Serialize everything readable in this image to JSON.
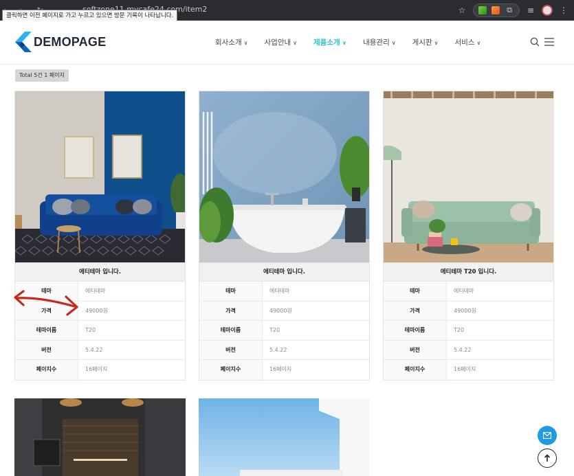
{
  "browser": {
    "url": "softzone11.mycafe24.com/item2",
    "tooltip": "클릭하면 이전 페이지로 가고 누르고 있으면 방문 기록이 나타납니다."
  },
  "site": {
    "logo_text": "DEMOPAGE",
    "nav": [
      {
        "label": "회사소개",
        "active": false
      },
      {
        "label": "사업안내",
        "active": false
      },
      {
        "label": "제품소개",
        "active": true
      },
      {
        "label": "내용관리",
        "active": false
      },
      {
        "label": "게시판",
        "active": false
      },
      {
        "label": "서비스",
        "active": false
      }
    ],
    "accent_color": "#26c6d0"
  },
  "listing": {
    "total_label": "Total 5건 1 페이지"
  },
  "products": [
    {
      "title": "에티테마 입니다.",
      "specs": [
        {
          "key": "테마",
          "value": "에티테마"
        },
        {
          "key": "가격",
          "value": "49000원"
        },
        {
          "key": "테마이름",
          "value": "T20"
        },
        {
          "key": "버전",
          "value": "5.4.22"
        },
        {
          "key": "페이지수",
          "value": "16페이지"
        }
      ]
    },
    {
      "title": "에티테마 입니다.",
      "specs": [
        {
          "key": "테마",
          "value": "에티테마"
        },
        {
          "key": "가격",
          "value": "49000원"
        },
        {
          "key": "테마이름",
          "value": "T20"
        },
        {
          "key": "버전",
          "value": "5.4.22"
        },
        {
          "key": "페이지수",
          "value": "16페이지"
        }
      ]
    },
    {
      "title": "에티테마 T20 입니다.",
      "specs": [
        {
          "key": "테마",
          "value": "에티테마"
        },
        {
          "key": "가격",
          "value": "49000원"
        },
        {
          "key": "테마이름",
          "value": "T20"
        },
        {
          "key": "버전",
          "value": "5.4.22"
        },
        {
          "key": "페이지수",
          "value": "16페이지"
        }
      ]
    }
  ],
  "icons": {
    "search": "search-icon",
    "menu": "hamburger-menu-icon",
    "mail": "mail-icon",
    "scroll_top": "arrow-up-icon"
  }
}
